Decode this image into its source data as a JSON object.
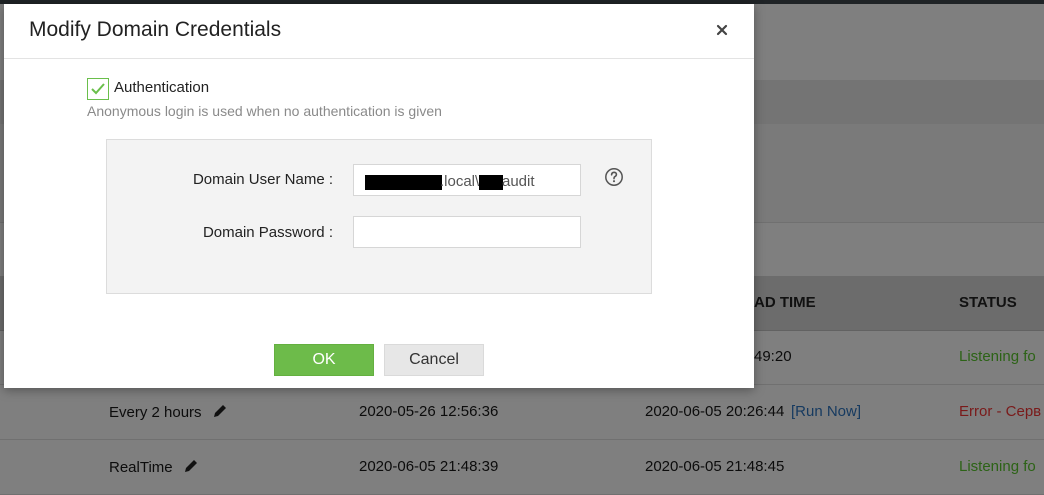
{
  "dialog": {
    "title": "Modify Domain Credentials",
    "close_label": "×",
    "auth_checkbox": {
      "label": "Authentication",
      "checked": true
    },
    "auth_hint": "Anonymous login is used when no authentication is given",
    "user_field": {
      "label": "Domain User Name :",
      "value_segment_1": ".local\\",
      "value_segment_2": "audit",
      "redacted": true
    },
    "password_field": {
      "label": "Domain Password :",
      "value": ""
    },
    "help_icon": "help-circle-icon",
    "ok_label": "OK",
    "cancel_label": "Cancel"
  },
  "background_table": {
    "headers": {
      "load_time_partial": "AD TIME",
      "status": "STATUS"
    },
    "rows": [
      {
        "schedule": "",
        "created": "",
        "load_time": "49:20",
        "run_now": "",
        "status": "Listening fo"
      },
      {
        "schedule": "Every 2 hours",
        "created": "2020-05-26 12:56:36",
        "load_time": "2020-06-05 20:26:44",
        "run_now": "[Run Now]",
        "status": "Error - Серв"
      },
      {
        "schedule": "RealTime",
        "created": "2020-06-05 21:48:39",
        "load_time": "2020-06-05 21:48:45",
        "run_now": "",
        "status": "Listening fo"
      }
    ]
  },
  "colors": {
    "accent_green": "#6dbb4a",
    "status_ok": "#2c6316",
    "status_error": "#7a1a1a",
    "link": "#163a60"
  }
}
